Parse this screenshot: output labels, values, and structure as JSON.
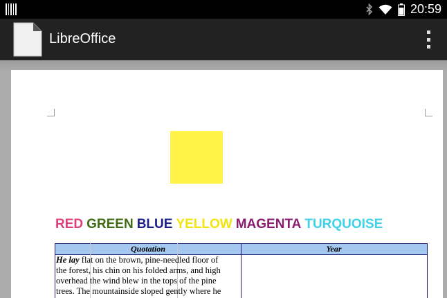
{
  "status_bar": {
    "time": "20:59",
    "icons": [
      "notification-icon",
      "bluetooth-icon",
      "wifi-icon",
      "battery-icon"
    ]
  },
  "app_bar": {
    "title": "LibreOffice",
    "icons": [
      "libreoffice-document-icon",
      "overflow-menu-icon"
    ]
  },
  "document": {
    "color_words": [
      {
        "text": "RED",
        "color": "#e0407a"
      },
      {
        "text": "GREEN",
        "color": "#3f6b12"
      },
      {
        "text": "BLUE",
        "color": "#1b1f8c"
      },
      {
        "text": "YELLOW",
        "color": "#f2e40c"
      },
      {
        "text": "MAGENTA",
        "color": "#8a1b6e"
      },
      {
        "text": "TURQUOISE",
        "color": "#3fd1e8"
      }
    ],
    "table": {
      "headers": [
        "Quotation",
        "Year"
      ],
      "header_color": "#a4c8ef",
      "quotation_lead": "He lay",
      "quotation_lines": [
        " flat on the brown, pine-needled floor of",
        "the forest, his chin on his folded arms, and high",
        "overhead the wind blew in the tops of the pine",
        "trees. The mountainside sloped gently where he"
      ]
    }
  }
}
